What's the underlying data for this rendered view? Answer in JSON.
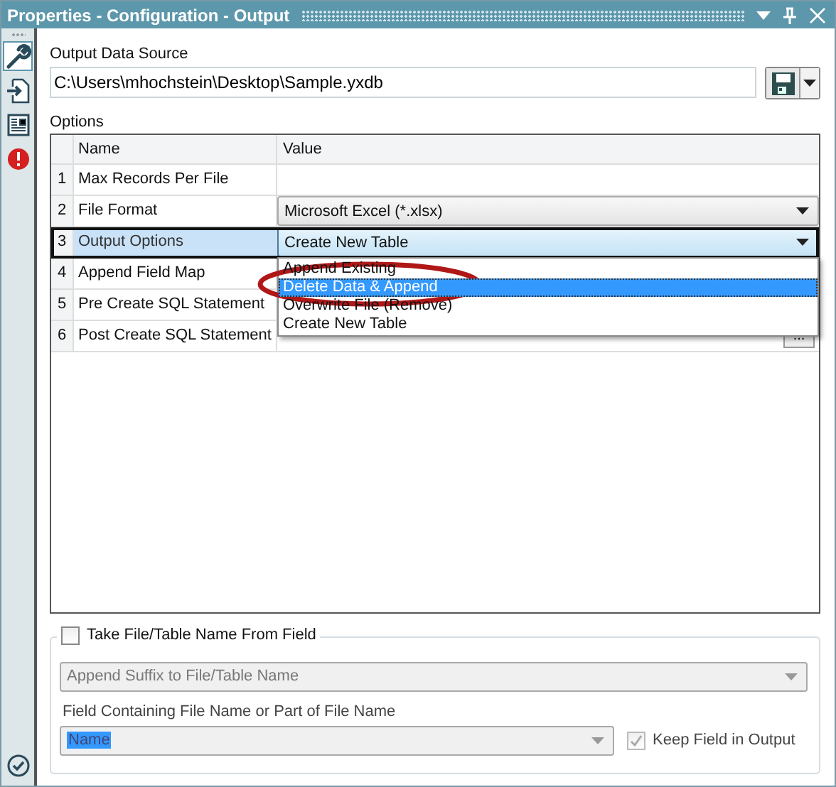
{
  "window": {
    "title": "Properties - Configuration - Output"
  },
  "sidebar": {
    "items": [
      {
        "kind": "wrench",
        "selected": true
      },
      {
        "kind": "input",
        "selected": false
      },
      {
        "kind": "doc",
        "selected": false
      },
      {
        "kind": "error",
        "selected": false
      }
    ],
    "footer": {
      "kind": "check"
    }
  },
  "output_data_source": {
    "label": "Output Data Source",
    "value": "C:\\Users\\mhochstein\\Desktop\\Sample.yxdb"
  },
  "options": {
    "label": "Options",
    "columns": [
      "Name",
      "Value"
    ],
    "rows": [
      {
        "number": "1",
        "name": "Max Records Per File",
        "kind": "text",
        "value": "",
        "selected": false
      },
      {
        "number": "2",
        "name": "File Format",
        "kind": "dropdown",
        "value": "Microsoft Excel (*.xlsx)",
        "selected": false
      },
      {
        "number": "3",
        "name": "Output Options",
        "kind": "dropdown",
        "value": "Create New Table",
        "selected": true
      },
      {
        "number": "4",
        "name": "Append Field Map",
        "kind": "text",
        "value": "",
        "selected": false
      },
      {
        "number": "5",
        "name": "Pre Create SQL Statement",
        "kind": "text",
        "value": "",
        "selected": false
      },
      {
        "number": "6",
        "name": "Post Create SQL Statement",
        "kind": "button",
        "value": "...",
        "selected": false
      }
    ]
  },
  "dropdown_list": {
    "options": [
      {
        "label": "Append Existing",
        "selected": false
      },
      {
        "label": "Delete Data & Append",
        "selected": true
      },
      {
        "label": "Overwrite File (Remove)",
        "selected": false
      },
      {
        "label": "Create New Table",
        "selected": false
      }
    ]
  },
  "name_from_field": {
    "label": "Take File/Table Name From Field",
    "checked": false,
    "mode": "Append Suffix to File/Table Name",
    "field_label": "Field Containing File Name or Part of File Name",
    "field_value": "Name",
    "keep_label": "Keep Field in Output",
    "keep_checked": true
  }
}
